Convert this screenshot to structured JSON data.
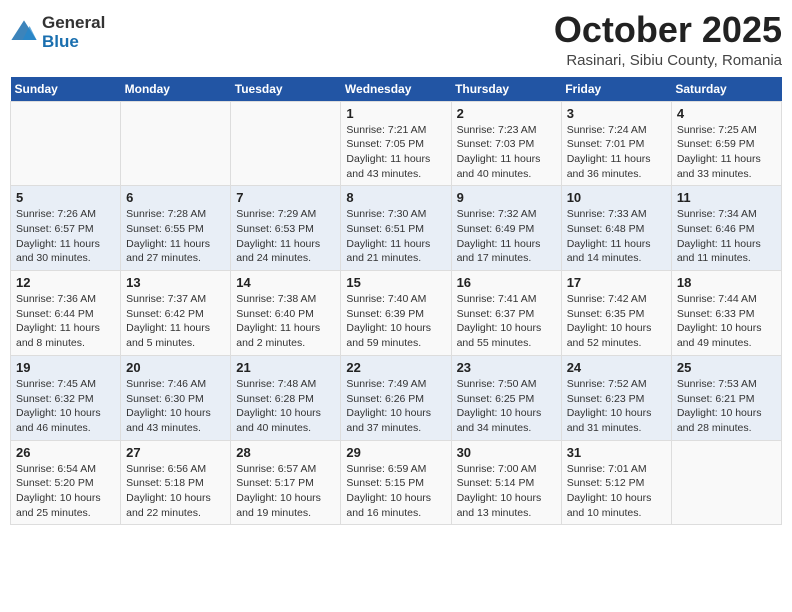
{
  "logo": {
    "general": "General",
    "blue": "Blue"
  },
  "title": "October 2025",
  "location": "Rasinari, Sibiu County, Romania",
  "weekdays": [
    "Sunday",
    "Monday",
    "Tuesday",
    "Wednesday",
    "Thursday",
    "Friday",
    "Saturday"
  ],
  "weeks": [
    [
      {
        "day": "",
        "info": ""
      },
      {
        "day": "",
        "info": ""
      },
      {
        "day": "",
        "info": ""
      },
      {
        "day": "1",
        "info": "Sunrise: 7:21 AM\nSunset: 7:05 PM\nDaylight: 11 hours and 43 minutes."
      },
      {
        "day": "2",
        "info": "Sunrise: 7:23 AM\nSunset: 7:03 PM\nDaylight: 11 hours and 40 minutes."
      },
      {
        "day": "3",
        "info": "Sunrise: 7:24 AM\nSunset: 7:01 PM\nDaylight: 11 hours and 36 minutes."
      },
      {
        "day": "4",
        "info": "Sunrise: 7:25 AM\nSunset: 6:59 PM\nDaylight: 11 hours and 33 minutes."
      }
    ],
    [
      {
        "day": "5",
        "info": "Sunrise: 7:26 AM\nSunset: 6:57 PM\nDaylight: 11 hours and 30 minutes."
      },
      {
        "day": "6",
        "info": "Sunrise: 7:28 AM\nSunset: 6:55 PM\nDaylight: 11 hours and 27 minutes."
      },
      {
        "day": "7",
        "info": "Sunrise: 7:29 AM\nSunset: 6:53 PM\nDaylight: 11 hours and 24 minutes."
      },
      {
        "day": "8",
        "info": "Sunrise: 7:30 AM\nSunset: 6:51 PM\nDaylight: 11 hours and 21 minutes."
      },
      {
        "day": "9",
        "info": "Sunrise: 7:32 AM\nSunset: 6:49 PM\nDaylight: 11 hours and 17 minutes."
      },
      {
        "day": "10",
        "info": "Sunrise: 7:33 AM\nSunset: 6:48 PM\nDaylight: 11 hours and 14 minutes."
      },
      {
        "day": "11",
        "info": "Sunrise: 7:34 AM\nSunset: 6:46 PM\nDaylight: 11 hours and 11 minutes."
      }
    ],
    [
      {
        "day": "12",
        "info": "Sunrise: 7:36 AM\nSunset: 6:44 PM\nDaylight: 11 hours and 8 minutes."
      },
      {
        "day": "13",
        "info": "Sunrise: 7:37 AM\nSunset: 6:42 PM\nDaylight: 11 hours and 5 minutes."
      },
      {
        "day": "14",
        "info": "Sunrise: 7:38 AM\nSunset: 6:40 PM\nDaylight: 11 hours and 2 minutes."
      },
      {
        "day": "15",
        "info": "Sunrise: 7:40 AM\nSunset: 6:39 PM\nDaylight: 10 hours and 59 minutes."
      },
      {
        "day": "16",
        "info": "Sunrise: 7:41 AM\nSunset: 6:37 PM\nDaylight: 10 hours and 55 minutes."
      },
      {
        "day": "17",
        "info": "Sunrise: 7:42 AM\nSunset: 6:35 PM\nDaylight: 10 hours and 52 minutes."
      },
      {
        "day": "18",
        "info": "Sunrise: 7:44 AM\nSunset: 6:33 PM\nDaylight: 10 hours and 49 minutes."
      }
    ],
    [
      {
        "day": "19",
        "info": "Sunrise: 7:45 AM\nSunset: 6:32 PM\nDaylight: 10 hours and 46 minutes."
      },
      {
        "day": "20",
        "info": "Sunrise: 7:46 AM\nSunset: 6:30 PM\nDaylight: 10 hours and 43 minutes."
      },
      {
        "day": "21",
        "info": "Sunrise: 7:48 AM\nSunset: 6:28 PM\nDaylight: 10 hours and 40 minutes."
      },
      {
        "day": "22",
        "info": "Sunrise: 7:49 AM\nSunset: 6:26 PM\nDaylight: 10 hours and 37 minutes."
      },
      {
        "day": "23",
        "info": "Sunrise: 7:50 AM\nSunset: 6:25 PM\nDaylight: 10 hours and 34 minutes."
      },
      {
        "day": "24",
        "info": "Sunrise: 7:52 AM\nSunset: 6:23 PM\nDaylight: 10 hours and 31 minutes."
      },
      {
        "day": "25",
        "info": "Sunrise: 7:53 AM\nSunset: 6:21 PM\nDaylight: 10 hours and 28 minutes."
      }
    ],
    [
      {
        "day": "26",
        "info": "Sunrise: 6:54 AM\nSunset: 5:20 PM\nDaylight: 10 hours and 25 minutes."
      },
      {
        "day": "27",
        "info": "Sunrise: 6:56 AM\nSunset: 5:18 PM\nDaylight: 10 hours and 22 minutes."
      },
      {
        "day": "28",
        "info": "Sunrise: 6:57 AM\nSunset: 5:17 PM\nDaylight: 10 hours and 19 minutes."
      },
      {
        "day": "29",
        "info": "Sunrise: 6:59 AM\nSunset: 5:15 PM\nDaylight: 10 hours and 16 minutes."
      },
      {
        "day": "30",
        "info": "Sunrise: 7:00 AM\nSunset: 5:14 PM\nDaylight: 10 hours and 13 minutes."
      },
      {
        "day": "31",
        "info": "Sunrise: 7:01 AM\nSunset: 5:12 PM\nDaylight: 10 hours and 10 minutes."
      },
      {
        "day": "",
        "info": ""
      }
    ]
  ]
}
